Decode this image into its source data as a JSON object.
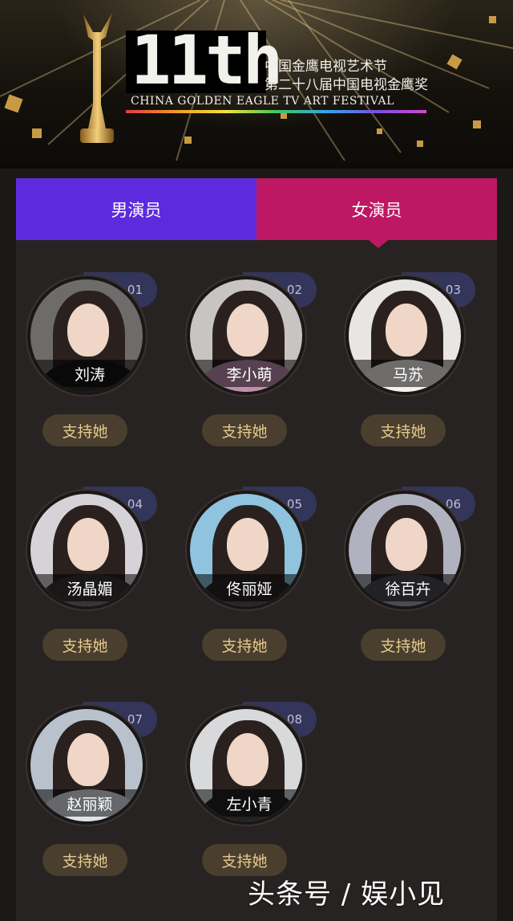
{
  "banner": {
    "logo_number": "11th",
    "logo_line1": "中国金鹰电视艺术节",
    "logo_line2": "第二十八届中国电视金鹰奖",
    "logo_english": "CHINA GOLDEN EAGLE TV ART FESTIVAL"
  },
  "tabs": {
    "male_label": "男演员",
    "female_label": "女演员",
    "selected": "female"
  },
  "colors": {
    "male_tab": "#5d2bdd",
    "female_tab": "#be1864",
    "vote_button_bg": "#4a3f2e",
    "vote_button_text": "#e6c98e",
    "number_tag": "#34355a"
  },
  "actresses": [
    {
      "number": "01",
      "name": "刘涛",
      "button": "支持她",
      "photo_bg": "#6e6c6a",
      "outfit": "#151515"
    },
    {
      "number": "02",
      "name": "李小萌",
      "button": "支持她",
      "photo_bg": "#c9c4c4",
      "outfit": "#c08fb0"
    },
    {
      "number": "03",
      "name": "马苏",
      "button": "支持她",
      "photo_bg": "#e8e6e4",
      "outfit": "#f4f2f0"
    },
    {
      "number": "04",
      "name": "汤晶媚",
      "button": "支持她",
      "photo_bg": "#d6d3d8",
      "outfit": "#3a3338"
    },
    {
      "number": "05",
      "name": "佟丽娅",
      "button": "支持她",
      "photo_bg": "#8fc3de",
      "outfit": "#2b2427"
    },
    {
      "number": "06",
      "name": "徐百卉",
      "button": "支持她",
      "photo_bg": "#b0b2bf",
      "outfit": "#4b4a55"
    },
    {
      "number": "07",
      "name": "赵丽颖",
      "button": "支持她",
      "photo_bg": "#b9c2cc",
      "outfit": "#dfe4ea"
    },
    {
      "number": "08",
      "name": "左小青",
      "button": "支持她",
      "photo_bg": "#d7d9db",
      "outfit": "#222222"
    }
  ],
  "watermark": "头条号 / 娱小见"
}
